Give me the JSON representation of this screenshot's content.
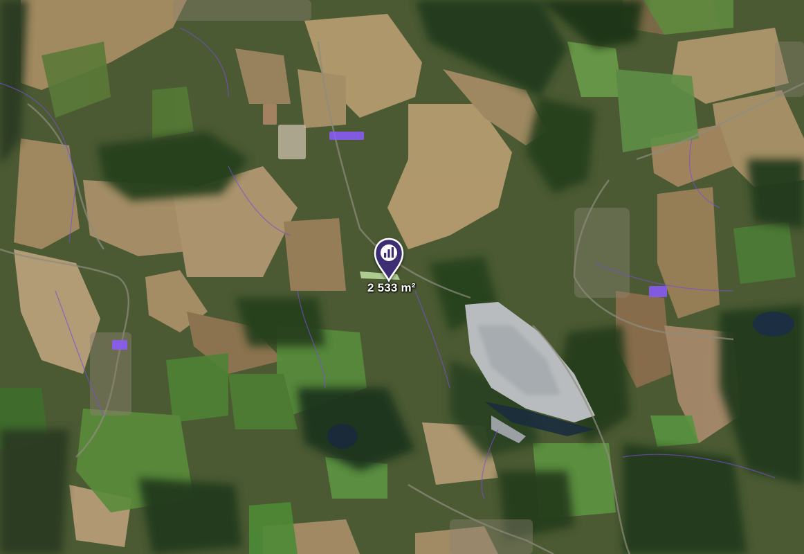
{
  "map": {
    "type": "satellite",
    "selected_parcel": {
      "area_label": "2 533 m²",
      "marker_icon": "building-chart-icon"
    },
    "colors": {
      "marker": "#3c2f73",
      "boundary": "#7b4fd6",
      "highlight": "#8c5bff"
    }
  }
}
